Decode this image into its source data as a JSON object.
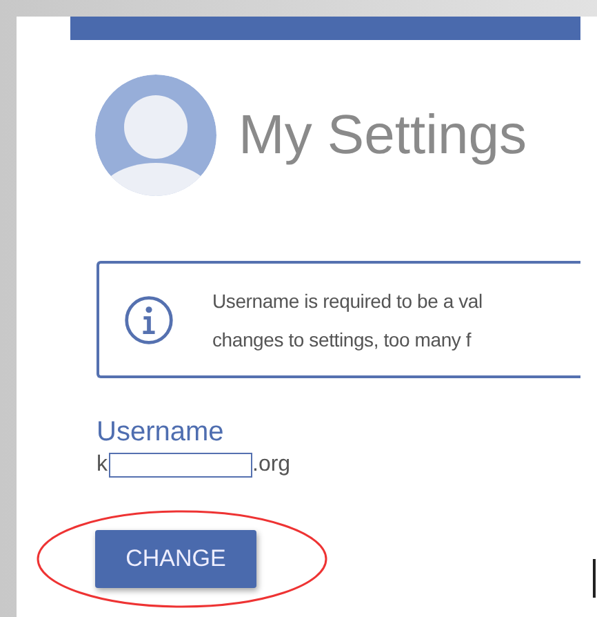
{
  "header": {
    "title": "My Settings"
  },
  "notice": {
    "lines": [
      "Username is required to be a val",
      "changes to settings, too many f"
    ]
  },
  "username": {
    "label": "Username",
    "value_start": "k",
    "value_end": ".org"
  },
  "buttons": [
    {
      "label": "CHANGE",
      "highlighted": true
    }
  ]
}
